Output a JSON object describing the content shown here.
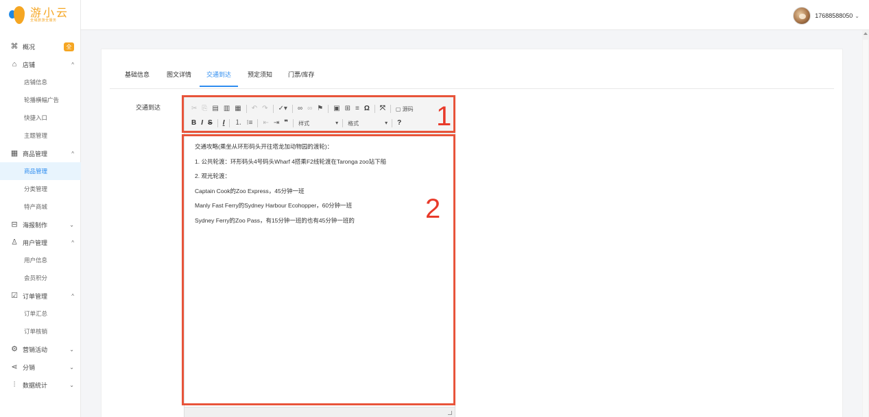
{
  "logo": {
    "title": "游小云",
    "subtitle": "全域旅游全服务"
  },
  "sidebar": {
    "items": [
      {
        "type": "group",
        "label": "概况",
        "icon": "command-icon",
        "badge": "全"
      },
      {
        "type": "group",
        "label": "店铺",
        "icon": "shop-icon",
        "chevron": "^"
      },
      {
        "type": "sub",
        "label": "店铺信息"
      },
      {
        "type": "sub",
        "label": "轮播横幅广告"
      },
      {
        "type": "sub",
        "label": "快捷入口"
      },
      {
        "type": "sub",
        "label": "主题管理"
      },
      {
        "type": "group",
        "label": "商品管理",
        "icon": "calendar-icon",
        "chevron": "^"
      },
      {
        "type": "sub",
        "label": "商品管理",
        "active": true
      },
      {
        "type": "sub",
        "label": "分类管理"
      },
      {
        "type": "sub",
        "label": "特产商城"
      },
      {
        "type": "group",
        "label": "海报制作",
        "icon": "map-icon",
        "chevron": "⌄"
      },
      {
        "type": "group",
        "label": "用户管理",
        "icon": "users-icon",
        "chevron": "^"
      },
      {
        "type": "sub",
        "label": "用户信息"
      },
      {
        "type": "sub",
        "label": "会员积分"
      },
      {
        "type": "group",
        "label": "订单管理",
        "icon": "checkbox-icon",
        "chevron": "^"
      },
      {
        "type": "sub",
        "label": "订单汇总"
      },
      {
        "type": "sub",
        "label": "订单核销"
      },
      {
        "type": "group",
        "label": "营销活动",
        "icon": "gear-icon",
        "chevron": "⌄"
      },
      {
        "type": "group",
        "label": "分销",
        "icon": "share-icon",
        "chevron": "⌄"
      },
      {
        "type": "group",
        "label": "数据统计",
        "icon": "bar-chart-icon",
        "chevron": "⌄"
      }
    ]
  },
  "header": {
    "username": "17688588050"
  },
  "tabs": [
    {
      "label": "基础信息"
    },
    {
      "label": "图文详情"
    },
    {
      "label": "交通到达",
      "active": true
    },
    {
      "label": "预定须知"
    },
    {
      "label": "门票/库存"
    }
  ],
  "form": {
    "field_label": "交通到达"
  },
  "editor": {
    "toolbar": {
      "format_combo_1": "样式",
      "format_combo_2": "格式",
      "source_label": "源码",
      "help_label": "?"
    },
    "content": [
      "交通攻略(乘坐从环形码头开往塔龙加动物园的渡轮)：",
      "1. 公共轮渡：环形码头4号码头Wharf 4搭乘F2线轮渡在Taronga zoo站下船",
      "2. 观光轮渡：",
      "Captain Cook的Zoo Express，45分钟一班",
      "Manly Fast Ferry的Sydney Harbour Ecohopper，60分钟一班",
      "Sydney Ferry的Zoo Pass，有15分钟一班的也有45分钟一班的"
    ]
  },
  "annotations": {
    "label_1": "1",
    "label_2": "2"
  },
  "colors": {
    "accent": "#2d8cf0",
    "brand": "#f5a623",
    "annotation": "#e8543a"
  }
}
